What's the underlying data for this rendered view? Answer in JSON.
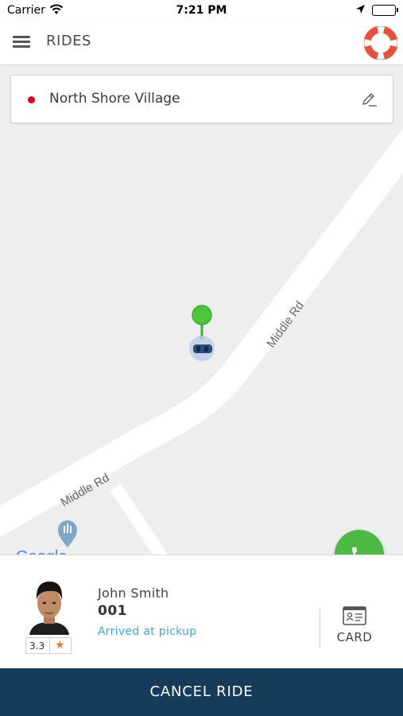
{
  "status_bar": {
    "carrier": "Carrier",
    "time": "7:21 PM"
  },
  "nav": {
    "title": "RIDES",
    "menu_icon": "hamburger-menu-icon",
    "help_icon": "lifebuoy-icon"
  },
  "pickup": {
    "address": "North Shore Village",
    "marker_color": "#e0001b",
    "edit_icon": "pencil-edit-icon"
  },
  "map": {
    "road_labels": [
      "Middle Rd",
      "Middle Rd"
    ],
    "driver_pin_color": "#4cb944",
    "google_logo": "Google"
  },
  "call_button": {
    "icon": "phone-icon",
    "color": "#4cb944"
  },
  "driver": {
    "name": "John Smith",
    "vehicle": "001",
    "status": "Arrived at pickup",
    "rating": "3.3",
    "status_color": "#3fa7d6",
    "star_color": "#f07c2c"
  },
  "card": {
    "label": "CARD",
    "icon": "id-card-icon"
  },
  "cancel": {
    "label": "CANCEL RIDE",
    "color": "#163c5c"
  }
}
